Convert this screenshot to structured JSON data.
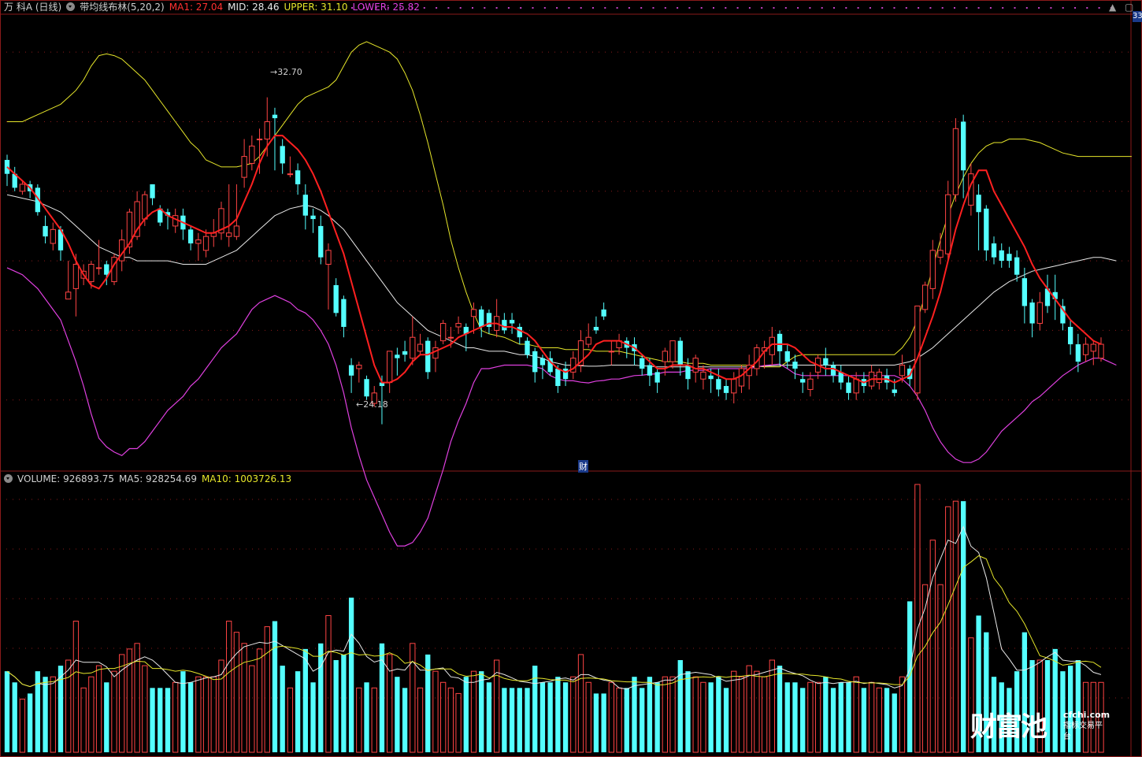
{
  "header": {
    "stock_name": "万 科A (日线)",
    "indicator_name": "带均线布林(5,20,2)",
    "ma1_label": "MA1: 27.04",
    "mid_label": "MID: 28.46",
    "upper_label": "UPPER: 31.10",
    "lower_label": "LOWER: 25.82",
    "top_right_axis": "33"
  },
  "volume_header": {
    "volume_label": "VOLUME: 926893.75",
    "ma5_label": "MA5: 928254.69",
    "ma10_label": "MA10: 1003726.13"
  },
  "annotations": {
    "high_label": "32.70",
    "low_label": "24.18",
    "event_marker": "财"
  },
  "watermark": {
    "brand": "财富池",
    "domain": "cfchi.com",
    "slogan": "指标交易平台"
  },
  "icons": {
    "dropdown": "chevron-down-icon",
    "up": "arrow-up-icon",
    "close": "close-icon",
    "minimize": "minimize-icon",
    "scale": "scale-icon"
  },
  "colors": {
    "up_candle": "#ff4444",
    "down_candle": "#54ffff",
    "ma1": "#ff2020",
    "mid": "#e8e8e8",
    "upper": "#e6e62a",
    "lower": "#e040e0",
    "grid": "#8a1a1a"
  },
  "chart_data": {
    "type": "candlestick",
    "price_series": {
      "candles": [
        [
          30.9,
          30.5,
          31.05,
          30.15
        ],
        [
          30.5,
          30.1,
          30.7,
          30.0
        ],
        [
          30.0,
          30.2,
          30.3,
          29.9
        ],
        [
          30.2,
          30.0,
          30.3,
          29.8
        ],
        [
          30.1,
          29.4,
          30.2,
          29.3
        ],
        [
          29.0,
          28.7,
          29.3,
          28.5
        ],
        [
          28.5,
          28.9,
          29.1,
          28.3
        ],
        [
          28.9,
          28.3,
          29.0,
          28.0
        ],
        [
          26.9,
          27.1,
          28.0,
          26.9
        ],
        [
          27.2,
          27.9,
          28.2,
          26.4
        ],
        [
          27.5,
          27.7,
          27.9,
          27.3
        ],
        [
          27.4,
          27.9,
          28.0,
          27.2
        ],
        [
          27.8,
          27.8,
          28.6,
          27.6
        ],
        [
          27.9,
          27.6,
          28.0,
          27.3
        ],
        [
          27.4,
          28.1,
          28.2,
          27.3
        ],
        [
          28.0,
          28.6,
          28.9,
          27.7
        ],
        [
          28.4,
          29.4,
          29.5,
          28.2
        ],
        [
          28.7,
          29.7,
          30.0,
          28.6
        ],
        [
          29.2,
          29.9,
          30.0,
          29.0
        ],
        [
          30.2,
          29.8,
          30.2,
          29.6
        ],
        [
          29.5,
          29.1,
          29.6,
          29.0
        ],
        [
          29.4,
          29.3,
          29.5,
          28.9
        ],
        [
          29.0,
          29.3,
          29.5,
          28.8
        ],
        [
          29.3,
          28.9,
          29.5,
          28.6
        ],
        [
          28.9,
          28.5,
          29.0,
          28.3
        ],
        [
          28.5,
          28.6,
          28.8,
          28.0
        ],
        [
          28.3,
          28.7,
          28.9,
          28.1
        ],
        [
          28.7,
          28.8,
          29.2,
          28.4
        ],
        [
          28.8,
          29.5,
          29.7,
          28.6
        ],
        [
          28.7,
          28.8,
          30.2,
          28.4
        ],
        [
          28.7,
          29.0,
          30.2,
          28.6
        ],
        [
          30.4,
          31.0,
          31.5,
          30.1
        ],
        [
          30.8,
          31.3,
          31.6,
          30.6
        ],
        [
          31.5,
          31.5,
          31.8,
          30.5
        ],
        [
          31.5,
          32.0,
          32.7,
          31.0
        ],
        [
          32.2,
          32.1,
          32.4,
          30.6
        ],
        [
          31.3,
          30.8,
          31.5,
          30.5
        ],
        [
          30.5,
          30.5,
          31.0,
          30.4
        ],
        [
          30.6,
          30.2,
          30.8,
          29.9
        ],
        [
          29.9,
          29.3,
          30.2,
          28.9
        ],
        [
          29.3,
          29.2,
          29.5,
          28.8
        ],
        [
          29.0,
          28.1,
          29.3,
          27.9
        ],
        [
          27.9,
          28.3,
          28.5,
          26.6
        ],
        [
          27.3,
          26.5,
          27.5,
          26.4
        ],
        [
          26.9,
          26.1,
          27.0,
          25.8
        ],
        [
          25.0,
          24.7,
          25.2,
          24.2
        ],
        [
          24.9,
          25.0,
          25.1,
          24.5
        ],
        [
          24.6,
          24.1,
          24.7,
          24.0
        ],
        [
          23.9,
          24.2,
          24.4,
          23.8
        ],
        [
          24.5,
          24.4,
          24.7,
          23.3
        ],
        [
          24.5,
          25.4,
          25.4,
          24.2
        ],
        [
          25.3,
          25.2,
          25.5,
          24.7
        ],
        [
          25.4,
          25.3,
          25.7,
          25.1
        ],
        [
          25.2,
          25.8,
          26.4,
          25.0
        ],
        [
          25.4,
          25.6,
          25.9,
          25.3
        ],
        [
          25.7,
          24.8,
          25.8,
          24.6
        ],
        [
          25.2,
          25.5,
          25.7,
          24.8
        ],
        [
          25.7,
          26.2,
          26.3,
          25.6
        ],
        [
          25.8,
          25.8,
          26.1,
          25.5
        ],
        [
          26.1,
          26.2,
          26.4,
          25.9
        ],
        [
          26.1,
          25.9,
          26.2,
          25.4
        ],
        [
          26.4,
          26.6,
          26.8,
          25.9
        ],
        [
          26.6,
          26.1,
          26.7,
          25.8
        ],
        [
          26.5,
          26.1,
          26.6,
          25.9
        ],
        [
          26.0,
          26.4,
          26.9,
          25.8
        ],
        [
          26.3,
          26.0,
          26.5,
          25.9
        ],
        [
          26.3,
          26.2,
          26.5,
          25.9
        ],
        [
          26.1,
          25.8,
          26.2,
          25.6
        ],
        [
          25.7,
          25.3,
          25.8,
          25.2
        ],
        [
          25.4,
          24.8,
          25.5,
          24.5
        ],
        [
          25.2,
          25.0,
          25.3,
          24.6
        ],
        [
          25.2,
          24.8,
          25.4,
          24.7
        ],
        [
          24.9,
          24.4,
          25.0,
          24.2
        ],
        [
          24.9,
          24.6,
          25.1,
          24.4
        ],
        [
          24.8,
          25.2,
          25.4,
          24.6
        ],
        [
          25.0,
          25.7,
          26.0,
          24.8
        ],
        [
          25.6,
          25.8,
          26.2,
          25.5
        ],
        [
          26.1,
          26.0,
          26.4,
          25.9
        ],
        [
          26.6,
          26.4,
          26.8,
          26.3
        ],
        [
          25.4,
          25.4,
          25.7,
          25.0
        ],
        [
          25.5,
          25.7,
          25.9,
          25.3
        ],
        [
          25.7,
          25.5,
          25.8,
          25.2
        ],
        [
          25.6,
          25.4,
          25.8,
          25.0
        ],
        [
          25.2,
          24.9,
          25.3,
          24.7
        ],
        [
          25.0,
          24.7,
          25.2,
          24.4
        ],
        [
          24.8,
          24.5,
          24.9,
          24.2
        ],
        [
          25.1,
          25.4,
          25.5,
          24.7
        ],
        [
          25.1,
          25.7,
          25.7,
          24.9
        ],
        [
          25.7,
          25.0,
          25.8,
          24.7
        ],
        [
          25.0,
          24.6,
          25.2,
          24.3
        ],
        [
          24.8,
          25.2,
          25.3,
          24.5
        ],
        [
          24.6,
          24.8,
          25.0,
          24.3
        ],
        [
          24.7,
          24.6,
          24.9,
          24.2
        ],
        [
          24.6,
          24.3,
          24.9,
          24.1
        ],
        [
          24.4,
          24.2,
          24.6,
          24.0
        ],
        [
          24.2,
          24.6,
          24.8,
          23.9
        ],
        [
          24.4,
          24.9,
          25.0,
          24.2
        ],
        [
          24.7,
          25.0,
          25.3,
          24.3
        ],
        [
          24.9,
          25.5,
          25.6,
          24.7
        ],
        [
          25.4,
          25.5,
          25.7,
          24.9
        ],
        [
          25.3,
          25.8,
          26.1,
          25.0
        ],
        [
          25.9,
          25.4,
          26.0,
          25.0
        ],
        [
          25.4,
          25.1,
          25.6,
          24.9
        ],
        [
          25.1,
          24.9,
          25.3,
          24.6
        ],
        [
          24.6,
          24.5,
          24.8,
          24.2
        ],
        [
          24.3,
          24.6,
          24.8,
          24.1
        ],
        [
          24.8,
          25.2,
          25.3,
          24.6
        ],
        [
          25.2,
          25.0,
          25.5,
          24.7
        ],
        [
          25.0,
          24.7,
          25.1,
          24.5
        ],
        [
          24.8,
          24.5,
          25.0,
          24.3
        ],
        [
          24.5,
          24.2,
          24.7,
          24.0
        ],
        [
          24.2,
          24.6,
          24.8,
          24.0
        ],
        [
          24.6,
          24.4,
          24.8,
          24.2
        ],
        [
          24.4,
          24.8,
          25.0,
          24.3
        ],
        [
          24.5,
          24.8,
          24.9,
          24.3
        ],
        [
          24.7,
          24.5,
          24.9,
          24.3
        ],
        [
          24.3,
          24.2,
          24.6,
          24.1
        ],
        [
          24.7,
          25.0,
          25.3,
          24.5
        ],
        [
          24.9,
          24.6,
          25.0,
          24.4
        ],
        [
          24.2,
          26.7,
          26.7,
          24.0
        ],
        [
          26.6,
          27.3,
          27.4,
          26.5
        ],
        [
          27.2,
          28.3,
          28.6,
          26.9
        ],
        [
          28.1,
          28.3,
          28.8,
          27.9
        ],
        [
          28.2,
          29.9,
          30.3,
          28.0
        ],
        [
          29.9,
          31.8,
          32.1,
          29.7
        ],
        [
          32.0,
          30.6,
          32.2,
          29.8
        ],
        [
          29.6,
          30.5,
          30.8,
          29.3
        ],
        [
          29.9,
          29.4,
          30.2,
          28.3
        ],
        [
          29.5,
          28.3,
          29.6,
          28.0
        ],
        [
          28.5,
          28.1,
          28.7,
          27.9
        ],
        [
          28.3,
          28.0,
          28.5,
          27.8
        ],
        [
          28.2,
          28.0,
          28.4,
          27.8
        ],
        [
          28.1,
          27.6,
          28.3,
          27.4
        ],
        [
          27.5,
          26.7,
          27.8,
          26.2
        ],
        [
          26.8,
          26.2,
          26.9,
          25.8
        ],
        [
          26.2,
          26.8,
          27.1,
          26.0
        ],
        [
          27.2,
          26.7,
          27.6,
          26.5
        ],
        [
          27.1,
          26.9,
          27.6,
          26.3
        ],
        [
          26.7,
          26.2,
          26.9,
          26.0
        ],
        [
          26.1,
          25.6,
          26.3,
          25.3
        ],
        [
          25.6,
          25.1,
          25.9,
          24.8
        ],
        [
          25.3,
          25.6,
          25.8,
          25.1
        ],
        [
          25.4,
          25.6,
          25.7,
          25.0
        ],
        [
          25.2,
          25.6,
          25.8,
          25.1
        ]
      ],
      "ma1": [
        30.7,
        30.5,
        30.3,
        30.1,
        29.8,
        29.5,
        29.2,
        28.9,
        28.5,
        28.0,
        27.6,
        27.3,
        27.2,
        27.5,
        27.9,
        28.2,
        28.5,
        28.9,
        29.2,
        29.4,
        29.5,
        29.3,
        29.2,
        29.1,
        29.0,
        28.9,
        28.8,
        28.8,
        28.9,
        29.0,
        29.2,
        29.7,
        30.2,
        30.8,
        31.3,
        31.6,
        31.6,
        31.4,
        31.2,
        30.9,
        30.5,
        30.0,
        29.4,
        28.8,
        28.2,
        27.4,
        26.6,
        25.8,
        25.0,
        24.5,
        24.5,
        24.6,
        24.8,
        25.1,
        25.3,
        25.3,
        25.4,
        25.5,
        25.6,
        25.8,
        25.9,
        26.0,
        26.1,
        26.2,
        26.2,
        26.1,
        26.1,
        26.0,
        25.9,
        25.7,
        25.4,
        25.1,
        24.9,
        24.8,
        24.9,
        25.1,
        25.3,
        25.6,
        25.7,
        25.7,
        25.7,
        25.6,
        25.5,
        25.3,
        25.1,
        24.9,
        24.9,
        25.0,
        25.0,
        25.0,
        24.9,
        24.9,
        24.8,
        24.7,
        24.6,
        24.6,
        24.7,
        24.9,
        25.1,
        25.4,
        25.6,
        25.6,
        25.6,
        25.5,
        25.3,
        25.1,
        25.0,
        24.9,
        24.9,
        24.8,
        24.7,
        24.6,
        24.5,
        24.6,
        24.6,
        24.6,
        24.5,
        24.6,
        24.7,
        25.2,
        25.8,
        26.4,
        27.1,
        28.0,
        28.9,
        29.6,
        30.2,
        30.6,
        30.6,
        30.0,
        29.6,
        29.2,
        28.8,
        28.4,
        27.9,
        27.5,
        27.2,
        26.9,
        26.6,
        26.3,
        26.1,
        25.9,
        25.7,
        25.6
      ]
    },
    "bands": {
      "mid": [
        29.9,
        29.85,
        29.8,
        29.75,
        29.7,
        29.6,
        29.5,
        29.4,
        29.2,
        29.0,
        28.8,
        28.6,
        28.4,
        28.3,
        28.2,
        28.1,
        28.1,
        28.0,
        28.0,
        28.0,
        28.0,
        28.0,
        27.95,
        27.9,
        27.9,
        27.9,
        27.9,
        28.0,
        28.1,
        28.2,
        28.3,
        28.5,
        28.7,
        28.9,
        29.1,
        29.3,
        29.4,
        29.5,
        29.55,
        29.6,
        29.55,
        29.45,
        29.3,
        29.1,
        28.9,
        28.6,
        28.3,
        28.0,
        27.7,
        27.4,
        27.1,
        26.8,
        26.6,
        26.4,
        26.2,
        26.0,
        25.9,
        25.8,
        25.7,
        25.6,
        25.5,
        25.5,
        25.45,
        25.4,
        25.4,
        25.4,
        25.35,
        25.3,
        25.3,
        25.25,
        25.2,
        25.1,
        25.05,
        25.0,
        25.0,
        24.98,
        24.97,
        24.97,
        24.98,
        25.0,
        25.0,
        25.0,
        25.0,
        24.98,
        24.97,
        24.95,
        24.95,
        24.95,
        24.95,
        24.95,
        24.95,
        24.95,
        24.95,
        24.95,
        24.95,
        24.95,
        24.95,
        24.95,
        24.96,
        24.97,
        24.98,
        24.99,
        25.0,
        25.0,
        25.0,
        25.0,
        25.0,
        25.0,
        25.0,
        25.0,
        25.0,
        25.0,
        25.0,
        25.0,
        25.0,
        25.0,
        25.0,
        25.05,
        25.1,
        25.2,
        25.35,
        25.5,
        25.7,
        25.9,
        26.1,
        26.3,
        26.5,
        26.7,
        26.9,
        27.1,
        27.25,
        27.4,
        27.5,
        27.6,
        27.7,
        27.75,
        27.8,
        27.85,
        27.9,
        27.95,
        28.0,
        28.05,
        28.1,
        28.1,
        28.05,
        28.0
      ]
    },
    "upper": [
      32.0,
      32.0,
      32.0,
      32.1,
      32.2,
      32.3,
      32.4,
      32.5,
      32.7,
      32.9,
      33.2,
      33.6,
      33.9,
      33.95,
      33.9,
      33.8,
      33.6,
      33.4,
      33.2,
      32.9,
      32.6,
      32.3,
      32.0,
      31.7,
      31.4,
      31.2,
      30.9,
      30.8,
      30.7,
      30.7,
      30.7,
      30.75,
      30.8,
      31.0,
      31.3,
      31.6,
      31.9,
      32.2,
      32.5,
      32.7,
      32.8,
      32.9,
      33.0,
      33.2,
      33.6,
      34.0,
      34.2,
      34.3,
      34.2,
      34.1,
      34.0,
      33.8,
      33.4,
      32.9,
      32.2,
      31.4,
      30.5,
      29.6,
      28.6,
      27.8,
      27.1,
      26.5,
      26.0,
      25.9,
      25.85,
      25.8,
      25.7,
      25.6,
      25.6,
      25.55,
      25.5,
      25.5,
      25.5,
      25.45,
      25.45,
      25.45,
      25.45,
      25.4,
      25.4,
      25.4,
      25.4,
      25.35,
      25.3,
      25.25,
      25.2,
      25.15,
      25.1,
      25.1,
      25.1,
      25.05,
      25.05,
      25.05,
      25.0,
      25.0,
      25.0,
      25.0,
      25.0,
      25.0,
      24.97,
      24.95,
      24.95,
      24.95,
      25.1,
      25.25,
      25.3,
      25.3,
      25.3,
      25.3,
      25.3,
      25.3,
      25.3,
      25.3,
      25.3,
      25.3,
      25.3,
      25.3,
      25.3,
      25.5,
      25.8,
      26.3,
      27.0,
      27.8,
      28.6,
      29.3,
      29.9,
      30.4,
      30.8,
      31.1,
      31.3,
      31.4,
      31.4,
      31.5,
      31.5,
      31.5,
      31.45,
      31.4,
      31.3,
      31.2,
      31.1,
      31.05,
      31.0,
      31.0,
      31.0,
      31.0,
      31.0,
      31.0,
      31.0,
      31.0
    ]
  },
  "volume_series": []
}
